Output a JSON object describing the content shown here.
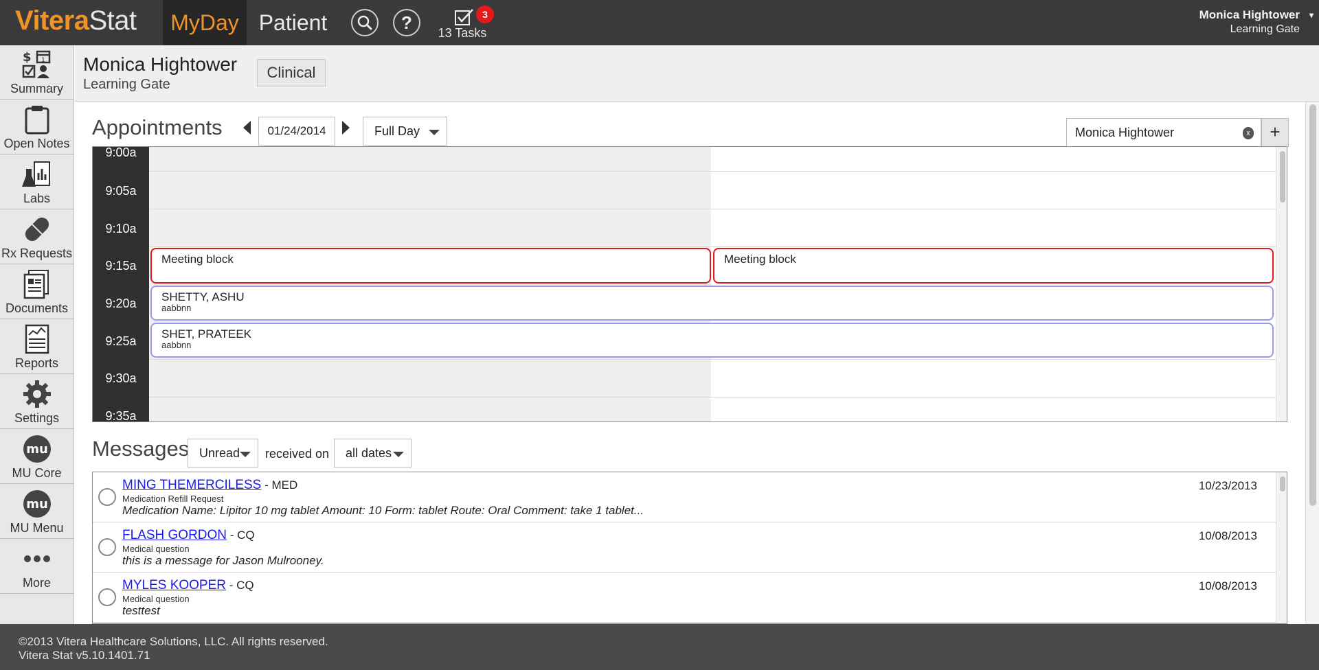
{
  "app": {
    "logo_part1": "Vitera",
    "logo_part2": "Stat",
    "tabs": [
      {
        "label": "MyDay",
        "active": true
      },
      {
        "label": "Patient",
        "active": false
      }
    ],
    "search_icon": "search-icon",
    "help_label": "?",
    "tasks": {
      "badge": "3",
      "label": "13 Tasks"
    },
    "user": {
      "name": "Monica Hightower",
      "location": "Learning Gate",
      "caret": "▾"
    },
    "accent_color": "#f0932a"
  },
  "sidebar": {
    "items": [
      {
        "label": "Summary",
        "icon": "summary-icon"
      },
      {
        "label": "Open Notes",
        "icon": "clipboard-icon"
      },
      {
        "label": "Labs",
        "icon": "labs-icon"
      },
      {
        "label": "Rx Requests",
        "icon": "pill-icon"
      },
      {
        "label": "Documents",
        "icon": "document-icon"
      },
      {
        "label": "Reports",
        "icon": "reports-icon"
      },
      {
        "label": "Settings",
        "icon": "gear-icon"
      },
      {
        "label": "MU Core",
        "icon": "mu-icon"
      },
      {
        "label": "MU Menu",
        "icon": "mu-icon"
      },
      {
        "label": "More",
        "icon": "more-icon"
      }
    ]
  },
  "patient_header": {
    "name": "Monica Hightower",
    "location": "Learning Gate",
    "clinical_label": "Clinical"
  },
  "appointments": {
    "title": "Appointments",
    "date": "01/24/2014",
    "view": "Full Day",
    "provider": "Monica Hightower",
    "clear_label": "x",
    "add_label": "+",
    "times": [
      "9:00a",
      "9:05a",
      "9:10a",
      "9:15a",
      "9:20a",
      "9:25a",
      "9:30a",
      "9:35a"
    ],
    "blocks": [
      {
        "title": "Meeting block",
        "kind": "meeting"
      },
      {
        "title": "Meeting block",
        "kind": "meeting"
      },
      {
        "title": "SHETTY, ASHU",
        "subtitle": "aabbnn",
        "kind": "patient"
      },
      {
        "title": "SHET, PRATEEK",
        "subtitle": "aabbnn",
        "kind": "patient"
      }
    ],
    "meeting_color": "#e01a1a",
    "patient_color": "#9a9ae8"
  },
  "messages": {
    "title": "Messages",
    "filter": "Unread",
    "received_on_label": "received on",
    "date_filter": "all dates",
    "items": [
      {
        "from": "MING THEMERCILESS",
        "tag": " - MED",
        "type": "Medication Refill Request",
        "body": "Medication Name: Lipitor 10 mg tablet Amount: 10 Form: tablet Route: Oral Comment: take 1 tablet...",
        "date": "10/23/2013"
      },
      {
        "from": "FLASH GORDON",
        "tag": " - CQ",
        "type": "Medical question",
        "body": "this is a message for Jason Mulrooney.",
        "date": "10/08/2013"
      },
      {
        "from": "MYLES KOOPER",
        "tag": " - CQ",
        "type": "Medical question",
        "body": "testtest",
        "date": "10/08/2013"
      }
    ]
  },
  "footer": {
    "copyright": "©2013 Vitera Healthcare Solutions, LLC. All rights reserved.",
    "version": "Vitera Stat v5.10.1401.71"
  }
}
